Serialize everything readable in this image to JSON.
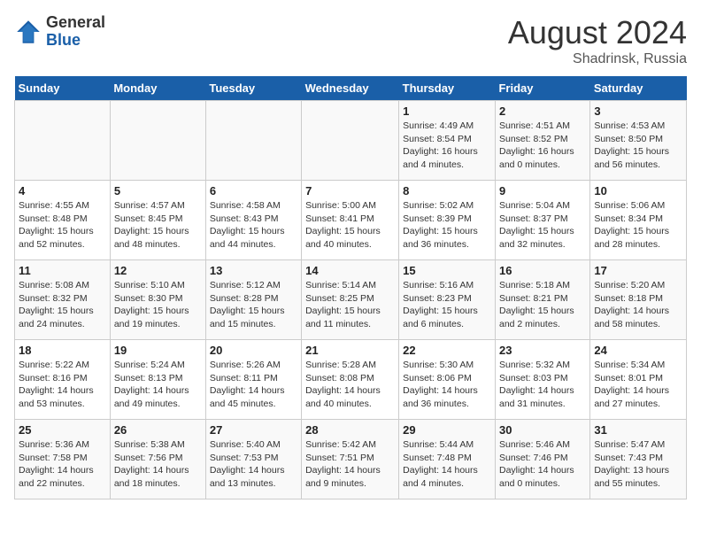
{
  "header": {
    "logo_general": "General",
    "logo_blue": "Blue",
    "title": "August 2024",
    "location": "Shadrinsk, Russia"
  },
  "days_of_week": [
    "Sunday",
    "Monday",
    "Tuesday",
    "Wednesday",
    "Thursday",
    "Friday",
    "Saturday"
  ],
  "weeks": [
    [
      {
        "day": "",
        "info": ""
      },
      {
        "day": "",
        "info": ""
      },
      {
        "day": "",
        "info": ""
      },
      {
        "day": "",
        "info": ""
      },
      {
        "day": "1",
        "info": "Sunrise: 4:49 AM\nSunset: 8:54 PM\nDaylight: 16 hours\nand 4 minutes."
      },
      {
        "day": "2",
        "info": "Sunrise: 4:51 AM\nSunset: 8:52 PM\nDaylight: 16 hours\nand 0 minutes."
      },
      {
        "day": "3",
        "info": "Sunrise: 4:53 AM\nSunset: 8:50 PM\nDaylight: 15 hours\nand 56 minutes."
      }
    ],
    [
      {
        "day": "4",
        "info": "Sunrise: 4:55 AM\nSunset: 8:48 PM\nDaylight: 15 hours\nand 52 minutes."
      },
      {
        "day": "5",
        "info": "Sunrise: 4:57 AM\nSunset: 8:45 PM\nDaylight: 15 hours\nand 48 minutes."
      },
      {
        "day": "6",
        "info": "Sunrise: 4:58 AM\nSunset: 8:43 PM\nDaylight: 15 hours\nand 44 minutes."
      },
      {
        "day": "7",
        "info": "Sunrise: 5:00 AM\nSunset: 8:41 PM\nDaylight: 15 hours\nand 40 minutes."
      },
      {
        "day": "8",
        "info": "Sunrise: 5:02 AM\nSunset: 8:39 PM\nDaylight: 15 hours\nand 36 minutes."
      },
      {
        "day": "9",
        "info": "Sunrise: 5:04 AM\nSunset: 8:37 PM\nDaylight: 15 hours\nand 32 minutes."
      },
      {
        "day": "10",
        "info": "Sunrise: 5:06 AM\nSunset: 8:34 PM\nDaylight: 15 hours\nand 28 minutes."
      }
    ],
    [
      {
        "day": "11",
        "info": "Sunrise: 5:08 AM\nSunset: 8:32 PM\nDaylight: 15 hours\nand 24 minutes."
      },
      {
        "day": "12",
        "info": "Sunrise: 5:10 AM\nSunset: 8:30 PM\nDaylight: 15 hours\nand 19 minutes."
      },
      {
        "day": "13",
        "info": "Sunrise: 5:12 AM\nSunset: 8:28 PM\nDaylight: 15 hours\nand 15 minutes."
      },
      {
        "day": "14",
        "info": "Sunrise: 5:14 AM\nSunset: 8:25 PM\nDaylight: 15 hours\nand 11 minutes."
      },
      {
        "day": "15",
        "info": "Sunrise: 5:16 AM\nSunset: 8:23 PM\nDaylight: 15 hours\nand 6 minutes."
      },
      {
        "day": "16",
        "info": "Sunrise: 5:18 AM\nSunset: 8:21 PM\nDaylight: 15 hours\nand 2 minutes."
      },
      {
        "day": "17",
        "info": "Sunrise: 5:20 AM\nSunset: 8:18 PM\nDaylight: 14 hours\nand 58 minutes."
      }
    ],
    [
      {
        "day": "18",
        "info": "Sunrise: 5:22 AM\nSunset: 8:16 PM\nDaylight: 14 hours\nand 53 minutes."
      },
      {
        "day": "19",
        "info": "Sunrise: 5:24 AM\nSunset: 8:13 PM\nDaylight: 14 hours\nand 49 minutes."
      },
      {
        "day": "20",
        "info": "Sunrise: 5:26 AM\nSunset: 8:11 PM\nDaylight: 14 hours\nand 45 minutes."
      },
      {
        "day": "21",
        "info": "Sunrise: 5:28 AM\nSunset: 8:08 PM\nDaylight: 14 hours\nand 40 minutes."
      },
      {
        "day": "22",
        "info": "Sunrise: 5:30 AM\nSunset: 8:06 PM\nDaylight: 14 hours\nand 36 minutes."
      },
      {
        "day": "23",
        "info": "Sunrise: 5:32 AM\nSunset: 8:03 PM\nDaylight: 14 hours\nand 31 minutes."
      },
      {
        "day": "24",
        "info": "Sunrise: 5:34 AM\nSunset: 8:01 PM\nDaylight: 14 hours\nand 27 minutes."
      }
    ],
    [
      {
        "day": "25",
        "info": "Sunrise: 5:36 AM\nSunset: 7:58 PM\nDaylight: 14 hours\nand 22 minutes."
      },
      {
        "day": "26",
        "info": "Sunrise: 5:38 AM\nSunset: 7:56 PM\nDaylight: 14 hours\nand 18 minutes."
      },
      {
        "day": "27",
        "info": "Sunrise: 5:40 AM\nSunset: 7:53 PM\nDaylight: 14 hours\nand 13 minutes."
      },
      {
        "day": "28",
        "info": "Sunrise: 5:42 AM\nSunset: 7:51 PM\nDaylight: 14 hours\nand 9 minutes."
      },
      {
        "day": "29",
        "info": "Sunrise: 5:44 AM\nSunset: 7:48 PM\nDaylight: 14 hours\nand 4 minutes."
      },
      {
        "day": "30",
        "info": "Sunrise: 5:46 AM\nSunset: 7:46 PM\nDaylight: 14 hours\nand 0 minutes."
      },
      {
        "day": "31",
        "info": "Sunrise: 5:47 AM\nSunset: 7:43 PM\nDaylight: 13 hours\nand 55 minutes."
      }
    ]
  ]
}
